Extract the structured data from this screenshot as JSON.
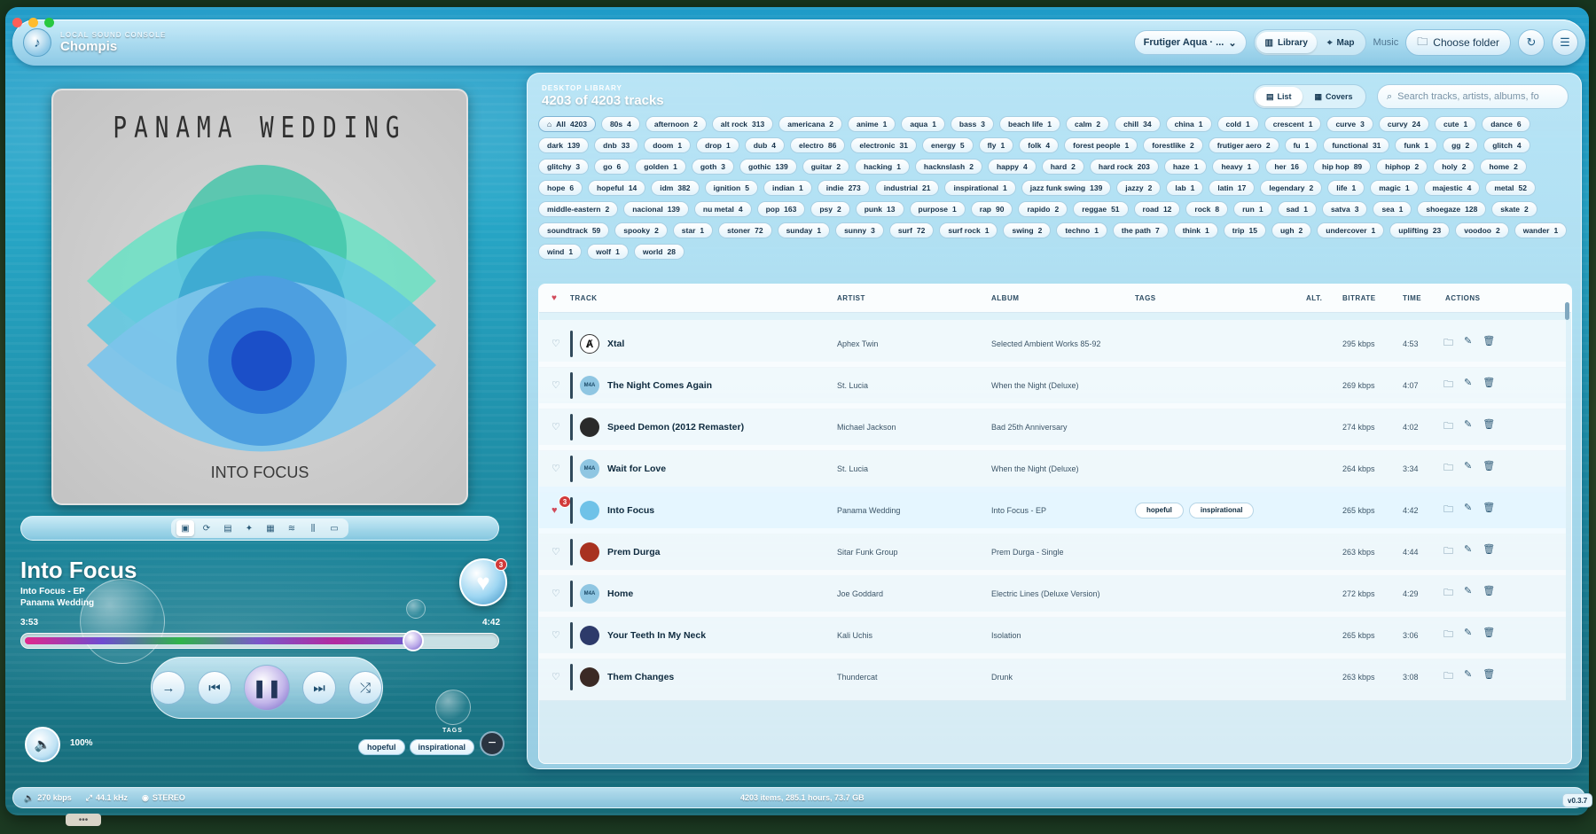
{
  "window": {
    "traffic": [
      {
        "color": "#ff5f57"
      },
      {
        "color": "#febc2e"
      },
      {
        "color": "#28c840"
      }
    ]
  },
  "topbar": {
    "subtitle": "LOCAL SOUND CONSOLE",
    "app_name": "Chompis",
    "theme_select": "Frutiger Aqua · ...",
    "views": [
      {
        "label": "Library",
        "active": true
      },
      {
        "label": "Map",
        "active": false
      }
    ],
    "music_label": "Music",
    "choose_folder": "Choose folder"
  },
  "player": {
    "art_title": "PANAMA WEDDING",
    "art_subtitle": "INTO FOCUS",
    "title": "Into Focus",
    "album": "Into Focus - EP",
    "artist": "Panama Wedding",
    "elapsed": "3:53",
    "total": "4:42",
    "progress_fraction": 0.826,
    "heart_badge": "3",
    "volume": "100%",
    "tags_label": "TAGS",
    "tags": [
      "hopeful",
      "inspirational"
    ]
  },
  "library": {
    "subtitle": "DESKTOP LIBRARY",
    "count_text": "4203 of 4203 tracks",
    "view_modes": [
      {
        "label": "List",
        "active": true
      },
      {
        "label": "Covers",
        "active": false
      }
    ],
    "search_placeholder": "Search tracks, artists, albums, fo",
    "chips": [
      {
        "label": "All",
        "count": "4203"
      },
      {
        "label": "80s",
        "count": "4"
      },
      {
        "label": "afternoon",
        "count": "2"
      },
      {
        "label": "alt rock",
        "count": "313"
      },
      {
        "label": "americana",
        "count": "2"
      },
      {
        "label": "anime",
        "count": "1"
      },
      {
        "label": "aqua",
        "count": "1"
      },
      {
        "label": "bass",
        "count": "3"
      },
      {
        "label": "beach life",
        "count": "1"
      },
      {
        "label": "calm",
        "count": "2"
      },
      {
        "label": "chill",
        "count": "34"
      },
      {
        "label": "china",
        "count": "1"
      },
      {
        "label": "cold",
        "count": "1"
      },
      {
        "label": "crescent",
        "count": "1"
      },
      {
        "label": "curve",
        "count": "3"
      },
      {
        "label": "curvy",
        "count": "24"
      },
      {
        "label": "cute",
        "count": "1"
      },
      {
        "label": "dance",
        "count": "6"
      },
      {
        "label": "dark",
        "count": "139"
      },
      {
        "label": "dnb",
        "count": "33"
      },
      {
        "label": "doom",
        "count": "1"
      },
      {
        "label": "drop",
        "count": "1"
      },
      {
        "label": "dub",
        "count": "4"
      },
      {
        "label": "electro",
        "count": "86"
      },
      {
        "label": "electronic",
        "count": "31"
      },
      {
        "label": "energy",
        "count": "5"
      },
      {
        "label": "fly",
        "count": "1"
      },
      {
        "label": "folk",
        "count": "4"
      },
      {
        "label": "forest people",
        "count": "1"
      },
      {
        "label": "forestlike",
        "count": "2"
      },
      {
        "label": "frutiger aero",
        "count": "2"
      },
      {
        "label": "fu",
        "count": "1"
      },
      {
        "label": "functional",
        "count": "31"
      },
      {
        "label": "funk",
        "count": "1"
      },
      {
        "label": "gg",
        "count": "2"
      },
      {
        "label": "glitch",
        "count": "4"
      },
      {
        "label": "glitchy",
        "count": "3"
      },
      {
        "label": "go",
        "count": "6"
      },
      {
        "label": "golden",
        "count": "1"
      },
      {
        "label": "goth",
        "count": "3"
      },
      {
        "label": "gothic",
        "count": "139"
      },
      {
        "label": "guitar",
        "count": "2"
      },
      {
        "label": "hacking",
        "count": "1"
      },
      {
        "label": "hacknslash",
        "count": "2"
      },
      {
        "label": "happy",
        "count": "4"
      },
      {
        "label": "hard",
        "count": "2"
      },
      {
        "label": "hard rock",
        "count": "203"
      },
      {
        "label": "haze",
        "count": "1"
      },
      {
        "label": "heavy",
        "count": "1"
      },
      {
        "label": "her",
        "count": "16"
      },
      {
        "label": "hip hop",
        "count": "89"
      },
      {
        "label": "hiphop",
        "count": "2"
      },
      {
        "label": "holy",
        "count": "2"
      },
      {
        "label": "home",
        "count": "2"
      },
      {
        "label": "hope",
        "count": "6"
      },
      {
        "label": "hopeful",
        "count": "14"
      },
      {
        "label": "idm",
        "count": "382"
      },
      {
        "label": "ignition",
        "count": "5"
      },
      {
        "label": "indian",
        "count": "1"
      },
      {
        "label": "indie",
        "count": "273"
      },
      {
        "label": "industrial",
        "count": "21"
      },
      {
        "label": "inspirational",
        "count": "1"
      },
      {
        "label": "jazz funk swing",
        "count": "139"
      },
      {
        "label": "jazzy",
        "count": "2"
      },
      {
        "label": "lab",
        "count": "1"
      },
      {
        "label": "latin",
        "count": "17"
      },
      {
        "label": "legendary",
        "count": "2"
      },
      {
        "label": "life",
        "count": "1"
      },
      {
        "label": "magic",
        "count": "1"
      },
      {
        "label": "majestic",
        "count": "4"
      },
      {
        "label": "metal",
        "count": "52"
      },
      {
        "label": "middle-eastern",
        "count": "2"
      },
      {
        "label": "nacional",
        "count": "139"
      },
      {
        "label": "nu metal",
        "count": "4"
      },
      {
        "label": "pop",
        "count": "163"
      },
      {
        "label": "psy",
        "count": "2"
      },
      {
        "label": "punk",
        "count": "13"
      },
      {
        "label": "purpose",
        "count": "1"
      },
      {
        "label": "rap",
        "count": "90"
      },
      {
        "label": "rapido",
        "count": "2"
      },
      {
        "label": "reggae",
        "count": "51"
      },
      {
        "label": "road",
        "count": "12"
      },
      {
        "label": "rock",
        "count": "8"
      },
      {
        "label": "run",
        "count": "1"
      },
      {
        "label": "sad",
        "count": "1"
      },
      {
        "label": "satva",
        "count": "3"
      },
      {
        "label": "sea",
        "count": "1"
      },
      {
        "label": "shoegaze",
        "count": "128"
      },
      {
        "label": "skate",
        "count": "2"
      },
      {
        "label": "soundtrack",
        "count": "59"
      },
      {
        "label": "spooky",
        "count": "2"
      },
      {
        "label": "star",
        "count": "1"
      },
      {
        "label": "stoner",
        "count": "72"
      },
      {
        "label": "sunday",
        "count": "1"
      },
      {
        "label": "sunny",
        "count": "3"
      },
      {
        "label": "surf",
        "count": "72"
      },
      {
        "label": "surf rock",
        "count": "1"
      },
      {
        "label": "swing",
        "count": "2"
      },
      {
        "label": "techno",
        "count": "1"
      },
      {
        "label": "the path",
        "count": "7"
      },
      {
        "label": "think",
        "count": "1"
      },
      {
        "label": "trip",
        "count": "15"
      },
      {
        "label": "ugh",
        "count": "2"
      },
      {
        "label": "undercover",
        "count": "1"
      },
      {
        "label": "uplifting",
        "count": "23"
      },
      {
        "label": "voodoo",
        "count": "2"
      },
      {
        "label": "wander",
        "count": "1"
      },
      {
        "label": "wind",
        "count": "1"
      },
      {
        "label": "wolf",
        "count": "1"
      },
      {
        "label": "world",
        "count": "28"
      }
    ],
    "columns": {
      "track": "TRACK",
      "artist": "ARTIST",
      "album": "ALBUM",
      "tags": "TAGS",
      "alt": "ALT.",
      "bitrate": "BITRATE",
      "time": "TIME",
      "actions": "ACTIONS"
    },
    "rows": [
      {
        "title": "Xtal",
        "artist": "Aphex Twin",
        "album": "Selected Ambient Works 85-92",
        "tags": [],
        "bitrate": "295 kbps",
        "time": "4:53",
        "thumb": "",
        "thumb_color": "#ffffff",
        "active": false
      },
      {
        "title": "The Night Comes Again",
        "artist": "St. Lucia",
        "album": "When the Night (Deluxe)",
        "tags": [],
        "bitrate": "269 kbps",
        "time": "4:07",
        "thumb": "M4A",
        "thumb_color": "#8fc6e2",
        "active": false
      },
      {
        "title": "Speed Demon (2012 Remaster)",
        "artist": "Michael Jackson",
        "album": "Bad 25th Anniversary",
        "tags": [],
        "bitrate": "274 kbps",
        "time": "4:02",
        "thumb": "",
        "thumb_color": "#2a2a2a",
        "active": false
      },
      {
        "title": "Wait for Love",
        "artist": "St. Lucia",
        "album": "When the Night (Deluxe)",
        "tags": [],
        "bitrate": "264 kbps",
        "time": "3:34",
        "thumb": "M4A",
        "thumb_color": "#8fc6e2",
        "active": false
      },
      {
        "title": "Into Focus",
        "artist": "Panama Wedding",
        "album": "Into Focus - EP",
        "tags": [
          "hopeful",
          "inspirational"
        ],
        "bitrate": "265 kbps",
        "time": "4:42",
        "thumb": "",
        "thumb_color": "#6fc2e8",
        "active": true,
        "badge": "3"
      },
      {
        "title": "Prem Durga",
        "artist": "Sitar Funk Group",
        "album": "Prem Durga - Single",
        "tags": [],
        "bitrate": "263 kbps",
        "time": "4:44",
        "thumb": "",
        "thumb_color": "#a83220",
        "active": false
      },
      {
        "title": "Home",
        "artist": "Joe Goddard",
        "album": "Electric Lines (Deluxe Version)",
        "tags": [],
        "bitrate": "272 kbps",
        "time": "4:29",
        "thumb": "M4A",
        "thumb_color": "#8fc6e2",
        "active": false
      },
      {
        "title": "Your Teeth In My Neck",
        "artist": "Kali Uchis",
        "album": "Isolation",
        "tags": [],
        "bitrate": "265 kbps",
        "time": "3:06",
        "thumb": "",
        "thumb_color": "#2d3a6a",
        "active": false
      },
      {
        "title": "Them Changes",
        "artist": "Thundercat",
        "album": "Drunk",
        "tags": [],
        "bitrate": "263 kbps",
        "time": "3:08",
        "thumb": "",
        "thumb_color": "#3b2a25",
        "active": false
      }
    ]
  },
  "status": {
    "bitrate": "270 kbps",
    "samplerate": "44.1 kHz",
    "channels": "STEREO",
    "summary": "4203 items, 285.1 hours, 73.7 GB",
    "version": "v0.3.7"
  }
}
